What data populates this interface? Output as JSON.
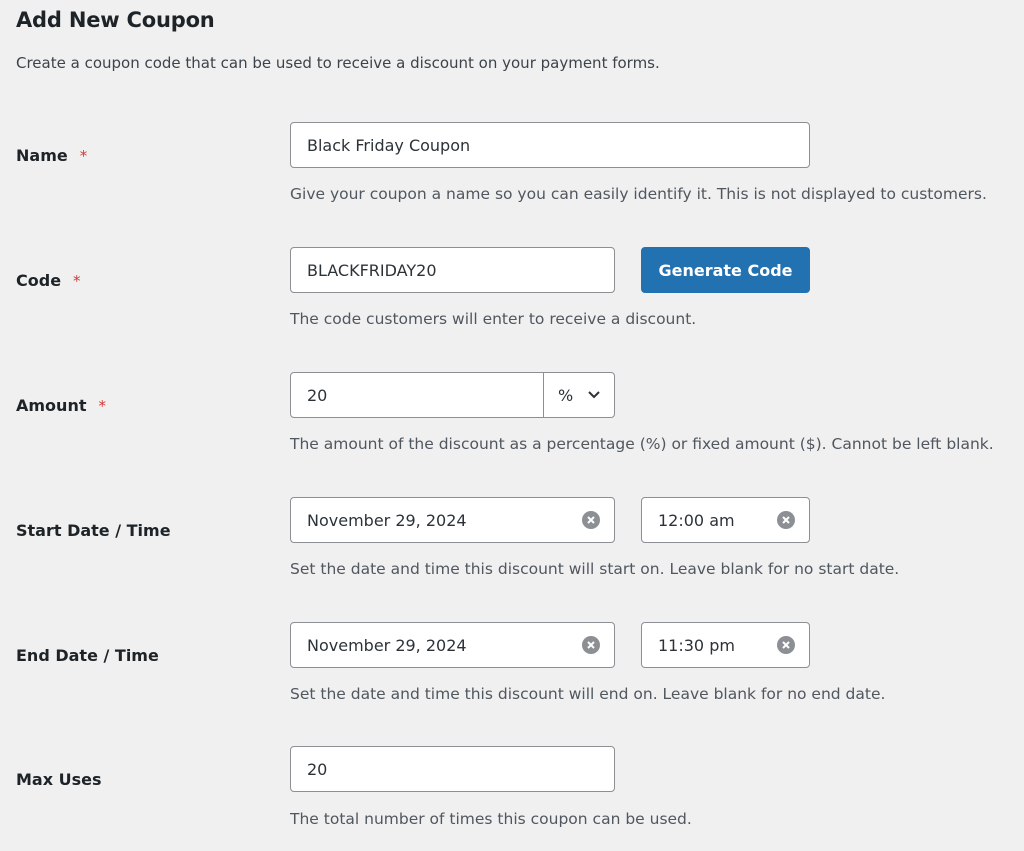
{
  "header": {
    "title": "Add New Coupon",
    "subtitle": "Create a coupon code that can be used to receive a discount on your payment forms."
  },
  "required_marker": "*",
  "fields": {
    "name": {
      "label": "Name",
      "value": "Black Friday Coupon",
      "description": "Give your coupon a name so you can easily identify it. This is not displayed to customers."
    },
    "code": {
      "label": "Code",
      "value": "BLACKFRIDAY20",
      "button_label": "Generate Code",
      "description": "The code customers will enter to receive a discount."
    },
    "amount": {
      "label": "Amount",
      "value": "20",
      "unit_selected": "%",
      "description": "The amount of the discount as a percentage (%) or fixed amount ($). Cannot be left blank."
    },
    "start": {
      "label": "Start Date / Time",
      "date": "November 29, 2024",
      "time": "12:00 am",
      "description": "Set the date and time this discount will start on. Leave blank for no start date."
    },
    "end": {
      "label": "End Date / Time",
      "date": "November 29, 2024",
      "time": "11:30 pm",
      "description": "Set the date and time this discount will end on. Leave blank for no end date."
    },
    "max_uses": {
      "label": "Max Uses",
      "value": "20",
      "description": "The total number of times this coupon can be used."
    }
  },
  "colors": {
    "primary_button": "#2271b1",
    "required": "#d63638",
    "background": "#f0f0f1"
  }
}
